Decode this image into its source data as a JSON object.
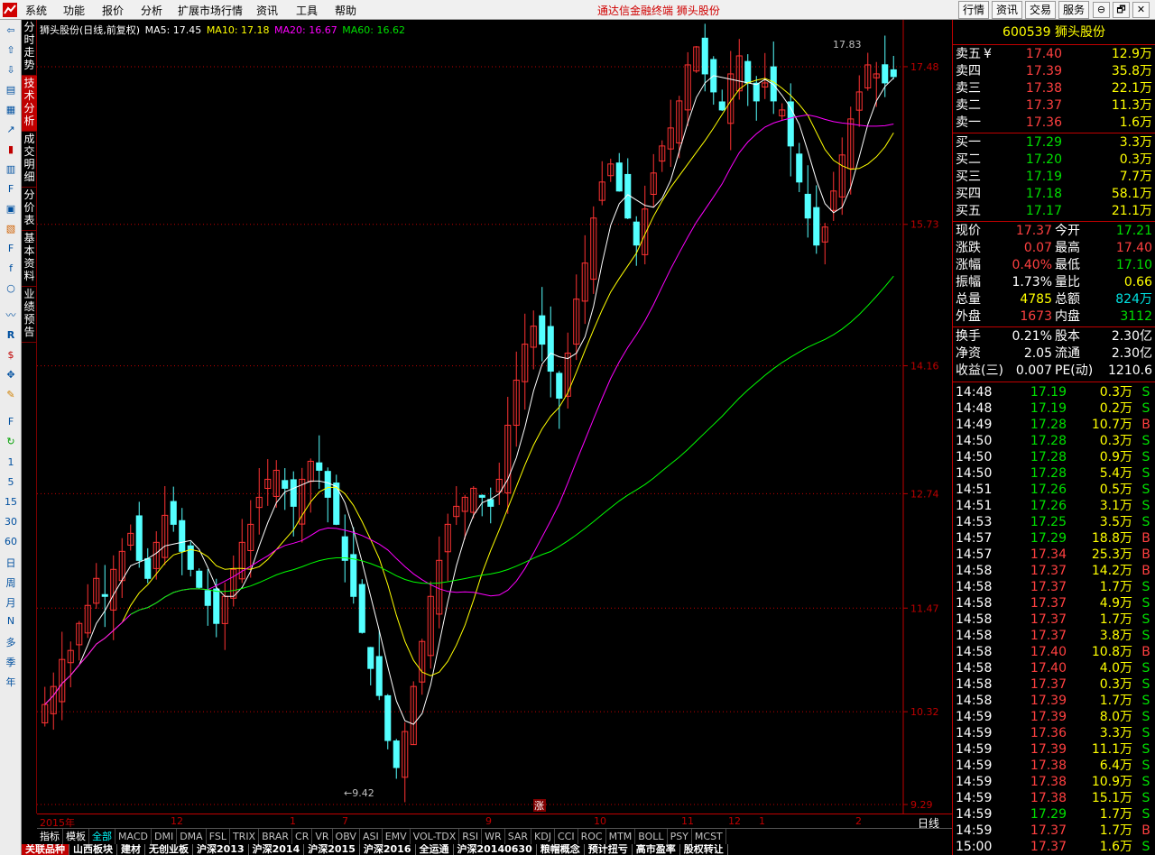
{
  "menu": {
    "items": [
      "系统",
      "功能",
      "报价",
      "分析",
      "扩展市场行情",
      "资讯",
      "工具",
      "帮助"
    ],
    "center_title": "通达信金融终端   狮头股份",
    "right_buttons": [
      "行情",
      "资讯",
      "交易",
      "服务"
    ],
    "window_buttons": [
      "⊖",
      "🗗",
      "🗖",
      "✕"
    ]
  },
  "left_tools": {
    "numbers": [
      "1",
      "5",
      "15",
      "30",
      "60",
      "日",
      "周",
      "月",
      "N",
      "多",
      "季",
      "年"
    ]
  },
  "vtabs": [
    "分时走势",
    "技术分析",
    "成交明细",
    "分价表",
    "基本资料",
    "业绩预告"
  ],
  "legend": {
    "title": "狮头股份(日线,前复权)",
    "ma5": "MA5: 17.45",
    "ma10": "MA10: 17.18",
    "ma20": "MA20: 16.67",
    "ma60": "MA60: 16.62"
  },
  "colors": {
    "ma5": "#ffffff",
    "ma10": "#ffff00",
    "ma20": "#ff00ff",
    "ma60": "#00ff00",
    "up": "#ff3232",
    "down": "#54ffff",
    "axis": "#c00000"
  },
  "chart_data": {
    "type": "candlestick",
    "price_axis_ticks": [
      "17.48",
      "15.73",
      "14.16",
      "12.74",
      "11.47",
      "10.32",
      "9.29"
    ],
    "high_label": "17.83",
    "low_label": "9.42",
    "rise_marker": "涨",
    "ylim": [
      9.29,
      17.9
    ],
    "period": "日线",
    "date_labels": [
      "2015年",
      "12",
      "1",
      "7",
      "9",
      "10",
      "11",
      "12",
      "1",
      "2"
    ],
    "closes": [
      10.4,
      10.6,
      10.9,
      11.0,
      11.3,
      11.5,
      11.8,
      11.6,
      11.9,
      12.1,
      12.3,
      12.0,
      11.8,
      12.2,
      12.5,
      12.4,
      12.1,
      11.9,
      11.7,
      11.5,
      11.3,
      11.6,
      11.9,
      12.2,
      12.4,
      12.7,
      12.9,
      13.0,
      12.8,
      12.6,
      12.9,
      13.1,
      13.0,
      12.7,
      12.4,
      12.0,
      11.6,
      11.2,
      10.8,
      10.5,
      10.0,
      9.7,
      10.1,
      10.6,
      11.1,
      11.6,
      12.0,
      12.4,
      12.6,
      12.7,
      12.8,
      12.7,
      12.6,
      12.9,
      13.5,
      14.0,
      14.4,
      14.6,
      14.4,
      14.1,
      13.8,
      14.3,
      14.9,
      15.3,
      15.8,
      16.2,
      16.4,
      16.1,
      15.8,
      15.5,
      15.9,
      16.3,
      16.6,
      16.8,
      17.1,
      17.5,
      17.7,
      17.4,
      17.2,
      17.0,
      17.4,
      17.6,
      17.3,
      17.1,
      17.3,
      17.1,
      17.0,
      16.6,
      16.2,
      15.8,
      15.5,
      15.7,
      16.1,
      16.5,
      16.9,
      17.2,
      17.5,
      17.4,
      17.3,
      17.37
    ]
  },
  "quote": {
    "code": "600539",
    "name": "狮头股份",
    "asks": [
      {
        "label": "卖五",
        "mark": "¥",
        "price": "17.40",
        "vol": "12.9万"
      },
      {
        "label": "卖四",
        "mark": "",
        "price": "17.39",
        "vol": "35.8万"
      },
      {
        "label": "卖三",
        "mark": "",
        "price": "17.38",
        "vol": "22.1万"
      },
      {
        "label": "卖二",
        "mark": "",
        "price": "17.37",
        "vol": "11.3万"
      },
      {
        "label": "卖一",
        "mark": "",
        "price": "17.36",
        "vol": "1.6万"
      }
    ],
    "bids": [
      {
        "label": "买一",
        "price": "17.29",
        "vol": "3.3万"
      },
      {
        "label": "买二",
        "price": "17.20",
        "vol": "0.3万"
      },
      {
        "label": "买三",
        "price": "17.19",
        "vol": "7.7万"
      },
      {
        "label": "买四",
        "price": "17.18",
        "vol": "58.1万"
      },
      {
        "label": "买五",
        "price": "17.17",
        "vol": "21.1万"
      }
    ],
    "stats": [
      {
        "l1": "现价",
        "v1": "17.37",
        "c1": "red",
        "l2": "今开",
        "v2": "17.21",
        "c2": "grn"
      },
      {
        "l1": "涨跌",
        "v1": "0.07",
        "c1": "red",
        "l2": "最高",
        "v2": "17.40",
        "c2": "red"
      },
      {
        "l1": "涨幅",
        "v1": "0.40%",
        "c1": "red",
        "l2": "最低",
        "v2": "17.10",
        "c2": "grn"
      },
      {
        "l1": "振幅",
        "v1": "1.73%",
        "c1": "wht",
        "l2": "量比",
        "v2": "0.66",
        "c2": "yel"
      },
      {
        "l1": "总量",
        "v1": "4785",
        "c1": "yel",
        "l2": "总额",
        "v2": "824万",
        "c2": "cyn"
      },
      {
        "l1": "外盘",
        "v1": "1673",
        "c1": "red",
        "l2": "内盘",
        "v2": "3112",
        "c2": "grn"
      }
    ],
    "fundamentals": [
      {
        "l1": "换手",
        "v1": "0.21%",
        "l2": "股本",
        "v2": "2.30亿"
      },
      {
        "l1": "净资",
        "v1": "2.05",
        "l2": "流通",
        "v2": "2.30亿"
      },
      {
        "l1": "收益(三)",
        "v1": "0.007",
        "l2": "PE(动)",
        "v2": "1210.6"
      }
    ]
  },
  "ticks": [
    {
      "t": "14:48",
      "p": "17.19",
      "c": "grn",
      "v": "0.3万",
      "f": "S"
    },
    {
      "t": "14:48",
      "p": "17.19",
      "c": "grn",
      "v": "0.2万",
      "f": "S"
    },
    {
      "t": "14:49",
      "p": "17.28",
      "c": "grn",
      "v": "10.7万",
      "f": "B"
    },
    {
      "t": "14:50",
      "p": "17.28",
      "c": "grn",
      "v": "0.3万",
      "f": "S"
    },
    {
      "t": "14:50",
      "p": "17.28",
      "c": "grn",
      "v": "0.9万",
      "f": "S"
    },
    {
      "t": "14:50",
      "p": "17.28",
      "c": "grn",
      "v": "5.4万",
      "f": "S"
    },
    {
      "t": "14:51",
      "p": "17.26",
      "c": "grn",
      "v": "0.5万",
      "f": "S"
    },
    {
      "t": "14:51",
      "p": "17.26",
      "c": "grn",
      "v": "3.1万",
      "f": "S"
    },
    {
      "t": "14:53",
      "p": "17.25",
      "c": "grn",
      "v": "3.5万",
      "f": "S"
    },
    {
      "t": "14:57",
      "p": "17.29",
      "c": "grn",
      "v": "18.8万",
      "f": "B"
    },
    {
      "t": "14:57",
      "p": "17.34",
      "c": "red",
      "v": "25.3万",
      "f": "B"
    },
    {
      "t": "14:58",
      "p": "17.37",
      "c": "red",
      "v": "14.2万",
      "f": "B"
    },
    {
      "t": "14:58",
      "p": "17.37",
      "c": "red",
      "v": "1.7万",
      "f": "S"
    },
    {
      "t": "14:58",
      "p": "17.37",
      "c": "red",
      "v": "4.9万",
      "f": "S"
    },
    {
      "t": "14:58",
      "p": "17.37",
      "c": "red",
      "v": "1.7万",
      "f": "S"
    },
    {
      "t": "14:58",
      "p": "17.37",
      "c": "red",
      "v": "3.8万",
      "f": "S"
    },
    {
      "t": "14:58",
      "p": "17.40",
      "c": "red",
      "v": "10.8万",
      "f": "B"
    },
    {
      "t": "14:58",
      "p": "17.40",
      "c": "red",
      "v": "4.0万",
      "f": "S"
    },
    {
      "t": "14:58",
      "p": "17.37",
      "c": "red",
      "v": "0.3万",
      "f": "S"
    },
    {
      "t": "14:58",
      "p": "17.39",
      "c": "red",
      "v": "1.7万",
      "f": "S"
    },
    {
      "t": "14:59",
      "p": "17.39",
      "c": "red",
      "v": "8.0万",
      "f": "S"
    },
    {
      "t": "14:59",
      "p": "17.36",
      "c": "red",
      "v": "3.3万",
      "f": "S"
    },
    {
      "t": "14:59",
      "p": "17.39",
      "c": "red",
      "v": "11.1万",
      "f": "S"
    },
    {
      "t": "14:59",
      "p": "17.38",
      "c": "red",
      "v": "6.4万",
      "f": "S"
    },
    {
      "t": "14:59",
      "p": "17.38",
      "c": "red",
      "v": "10.9万",
      "f": "S"
    },
    {
      "t": "14:59",
      "p": "17.38",
      "c": "red",
      "v": "15.1万",
      "f": "S"
    },
    {
      "t": "14:59",
      "p": "17.29",
      "c": "grn",
      "v": "1.7万",
      "f": "S"
    },
    {
      "t": "14:59",
      "p": "17.37",
      "c": "red",
      "v": "1.7万",
      "f": "B"
    },
    {
      "t": "15:00",
      "p": "17.37",
      "c": "red",
      "v": "1.6万",
      "f": "S"
    }
  ],
  "indicator_bar": [
    "指标",
    "模板",
    "全部",
    "MACD",
    "DMI",
    "DMA",
    "FSL",
    "TRIX",
    "BRAR",
    "CR",
    "VR",
    "OBV",
    "ASI",
    "EMV",
    "VOL-TDX",
    "RSI",
    "WR",
    "SAR",
    "KDJ",
    "CCI",
    "ROC",
    "MTM",
    "BOLL",
    "PSY",
    "MCST"
  ],
  "block_tabs": [
    "关联品种",
    "山西板块",
    "建材",
    "无创业板",
    "沪深2013",
    "沪深2014",
    "沪深2015",
    "沪深2016",
    "全运通",
    "沪深20140630",
    "粮帽概念",
    "预计扭亏",
    "高市盈率",
    "股权转让"
  ]
}
